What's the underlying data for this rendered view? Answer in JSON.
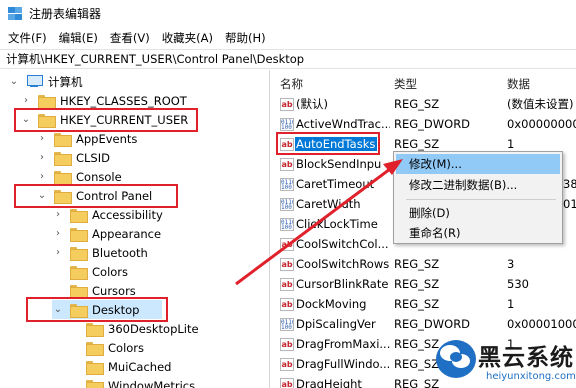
{
  "window": {
    "title": "注册表编辑器"
  },
  "menu": [
    "文件(F)",
    "编辑(E)",
    "查看(V)",
    "收藏夹(A)",
    "帮助(H)"
  ],
  "address": "计算机\\HKEY_CURRENT_USER\\Control Panel\\Desktop",
  "tree": [
    {
      "label": "计算机",
      "expander": "v",
      "kind": "pc"
    },
    {
      "label": "HKEY_CLASSES_ROOT",
      "expander": ">",
      "kind": "folder"
    },
    {
      "label": "HKEY_CURRENT_USER",
      "expander": "v",
      "kind": "folder"
    },
    {
      "label": "AppEvents",
      "expander": ">",
      "kind": "folder"
    },
    {
      "label": "CLSID",
      "expander": ">",
      "kind": "folder"
    },
    {
      "label": "Console",
      "expander": ">",
      "kind": "folder"
    },
    {
      "label": "Control Panel",
      "expander": "v",
      "kind": "folder"
    },
    {
      "label": "Accessibility",
      "expander": ">",
      "kind": "folder"
    },
    {
      "label": "Appearance",
      "expander": ">",
      "kind": "folder"
    },
    {
      "label": "Bluetooth",
      "expander": ">",
      "kind": "folder"
    },
    {
      "label": "Colors",
      "expander": "",
      "kind": "folder"
    },
    {
      "label": "Cursors",
      "expander": "",
      "kind": "folder"
    },
    {
      "label": "Desktop",
      "expander": "v",
      "kind": "folder",
      "selected": true
    },
    {
      "label": "360DesktopLite",
      "expander": "",
      "kind": "folder"
    },
    {
      "label": "Colors",
      "expander": "",
      "kind": "folder"
    },
    {
      "label": "MuiCached",
      "expander": "",
      "kind": "folder"
    },
    {
      "label": "WindowMetrics",
      "expander": "",
      "kind": "folder"
    }
  ],
  "columns": {
    "name": "名称",
    "type": "类型",
    "data": "数据"
  },
  "values": [
    {
      "name": "(默认)",
      "type": "REG_SZ",
      "data": "(数值未设置)",
      "icon": "ab"
    },
    {
      "name": "ActiveWndTrac...",
      "type": "REG_DWORD",
      "data": "0x00000000",
      "icon": "bin"
    },
    {
      "name": "AutoEndTasks",
      "type": "REG_SZ",
      "data": "1",
      "icon": "ab",
      "selected": true
    },
    {
      "name": "BlockSendInpu",
      "type": "",
      "data": "",
      "icon": "ab"
    },
    {
      "name": "CaretTimeout",
      "type": "",
      "data": "38",
      "icon": "bin"
    },
    {
      "name": "CaretWidth",
      "type": "",
      "data": "01",
      "icon": "bin"
    },
    {
      "name": "ClickLockTime",
      "type": "",
      "data": "",
      "icon": "bin"
    },
    {
      "name": "CoolSwitchCol...",
      "type": "",
      "data": "",
      "icon": "ab"
    },
    {
      "name": "CoolSwitchRows",
      "type": "REG_SZ",
      "data": "3",
      "icon": "ab"
    },
    {
      "name": "CursorBlinkRate",
      "type": "REG_SZ",
      "data": "530",
      "icon": "ab"
    },
    {
      "name": "DockMoving",
      "type": "REG_SZ",
      "data": "1",
      "icon": "ab"
    },
    {
      "name": "DpiScalingVer",
      "type": "REG_DWORD",
      "data": "0x00001000",
      "icon": "bin"
    },
    {
      "name": "DragFromMaxi...",
      "type": "REG_SZ",
      "data": "1",
      "icon": "ab"
    },
    {
      "name": "DragFullWindo...",
      "type": "REG_SZ",
      "data": "",
      "icon": "ab"
    },
    {
      "name": "DragHeight",
      "type": "REG_SZ",
      "data": "",
      "icon": "ab"
    }
  ],
  "context_menu": [
    "修改(M)...",
    "修改二进制数据(B)...",
    "删除(D)",
    "重命名(R)"
  ],
  "watermark": {
    "text": "黑云系统",
    "url": "heiyunxitong.com"
  },
  "colors": {
    "annotation": "#e0202a",
    "selection": "#0078d7",
    "menu_hover": "#91c9f7"
  }
}
